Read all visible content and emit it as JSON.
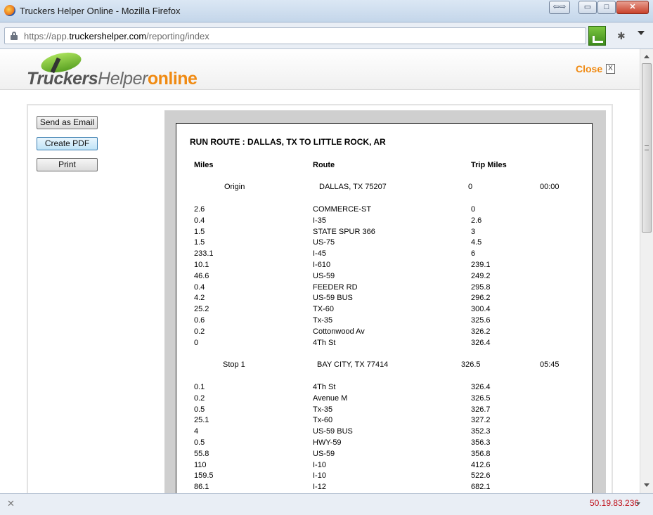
{
  "window": {
    "title": "Truckers Helper Online - Mozilla Firefox",
    "restore_down": "⇦⇨",
    "minimize": "▭",
    "maximize": "□",
    "close": "✕"
  },
  "browser": {
    "url_prefix": "https://app.",
    "url_domain": "truckershelper.com",
    "url_path": "/reporting/index"
  },
  "site": {
    "logo_trk": "Truckers",
    "logo_hlp": "Helper",
    "logo_onl": "online",
    "close_label": "Close",
    "close_x": "X"
  },
  "actions": {
    "email_label": "Send as Email",
    "pdf_label": "Create PDF",
    "print_label": "Print"
  },
  "report": {
    "title": "RUN ROUTE : DALLAS, TX TO LITTLE ROCK, AR",
    "headers": {
      "miles": "Miles",
      "route": "Route",
      "trip_miles": "Trip Miles"
    },
    "stops": [
      {
        "label": "Origin",
        "location": "DALLAS, TX 75207",
        "trip": "0",
        "time": "00:00"
      },
      {
        "label": "Stop 1",
        "location": "BAY CITY, TX 77414",
        "trip": "326.5",
        "time": "05:45"
      }
    ],
    "segments1": [
      {
        "miles": "2.6",
        "route": "COMMERCE-ST",
        "trip": "0"
      },
      {
        "miles": "0.4",
        "route": "I-35",
        "trip": "2.6"
      },
      {
        "miles": "1.5",
        "route": "STATE SPUR 366",
        "trip": "3"
      },
      {
        "miles": "1.5",
        "route": "US-75",
        "trip": "4.5"
      },
      {
        "miles": "233.1",
        "route": "I-45",
        "trip": "6"
      },
      {
        "miles": "10.1",
        "route": "I-610",
        "trip": "239.1"
      },
      {
        "miles": "46.6",
        "route": "US-59",
        "trip": "249.2"
      },
      {
        "miles": "0.4",
        "route": "FEEDER RD",
        "trip": "295.8"
      },
      {
        "miles": "4.2",
        "route": "US-59 BUS",
        "trip": "296.2"
      },
      {
        "miles": "25.2",
        "route": "TX-60",
        "trip": "300.4"
      },
      {
        "miles": "0.6",
        "route": "Tx-35",
        "trip": "325.6"
      },
      {
        "miles": "0.2",
        "route": "Cottonwood Av",
        "trip": "326.2"
      },
      {
        "miles": "0",
        "route": "4Th St",
        "trip": "326.4"
      }
    ],
    "segments2": [
      {
        "miles": "0.1",
        "route": "4Th St",
        "trip": "326.4"
      },
      {
        "miles": "0.2",
        "route": "Avenue M",
        "trip": "326.5"
      },
      {
        "miles": "0.5",
        "route": "Tx-35",
        "trip": "326.7"
      },
      {
        "miles": "25.1",
        "route": "Tx-60",
        "trip": "327.2"
      },
      {
        "miles": "4",
        "route": "US-59 BUS",
        "trip": "352.3"
      },
      {
        "miles": "0.5",
        "route": "HWY-59",
        "trip": "356.3"
      },
      {
        "miles": "55.8",
        "route": "US-59",
        "trip": "356.8"
      },
      {
        "miles": "110",
        "route": "I-10",
        "trip": "412.6"
      },
      {
        "miles": "159.5",
        "route": "I-10",
        "trip": "522.6"
      },
      {
        "miles": "86.1",
        "route": "I-12",
        "trip": "682.1"
      }
    ]
  },
  "status": {
    "close_x": "✕",
    "ip": "50.19.83.236"
  }
}
